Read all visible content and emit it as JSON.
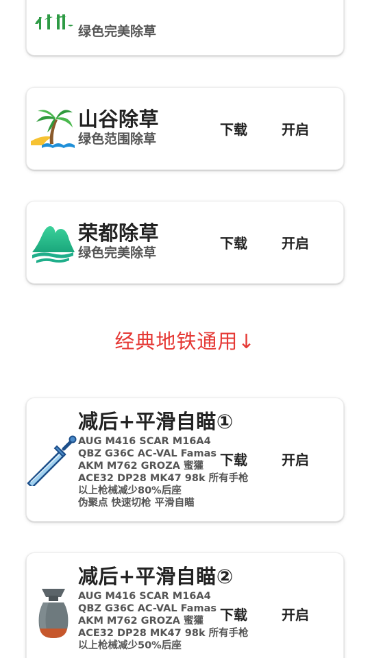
{
  "cards": [
    {
      "title": "",
      "subtitle": "绿色完美除草",
      "icon": "leaf-logo-icon"
    },
    {
      "title": "山谷除草",
      "subtitle": "绿色范围除草",
      "download_label": "下载",
      "open_label": "开启",
      "icon": "palm-tree-icon"
    },
    {
      "title": "荣都除草",
      "subtitle": "绿色完美除草",
      "download_label": "下载",
      "open_label": "开启",
      "icon": "mountain-icon"
    }
  ],
  "section_heading": "经典地铁通用↓",
  "aim_cards": [
    {
      "title": "减后+平滑自瞄①",
      "lines": [
        "AUG  M416  SCAR  M16A4",
        "QBZ  G36C  AC-VAL  Famas",
        "AKM  M762  GROZA  蜜獾",
        "ACE32  DP28  MK47  98k  所有手枪",
        "以上枪械减少80%后座",
        "伪聚点  快速切枪  平滑自瞄"
      ],
      "download_label": "下载",
      "open_label": "开启",
      "icon": "sword-icon"
    },
    {
      "title": "减后+平滑自瞄②",
      "lines": [
        "AUG  M416  SCAR  M16A4",
        "QBZ  G36C  AC-VAL  Famas",
        "AKM  M762  GROZA  蜜獾",
        "ACE32  DP28  MK47  98k  所有手枪",
        "以上枪械减少50%后座"
      ],
      "download_label": "下载",
      "open_label": "开启",
      "icon": "bomb-icon"
    }
  ],
  "colors": {
    "accent_red": "#e53935",
    "card_bg": "#ffffff",
    "text_dark": "#222222",
    "text_gray": "#555555"
  }
}
